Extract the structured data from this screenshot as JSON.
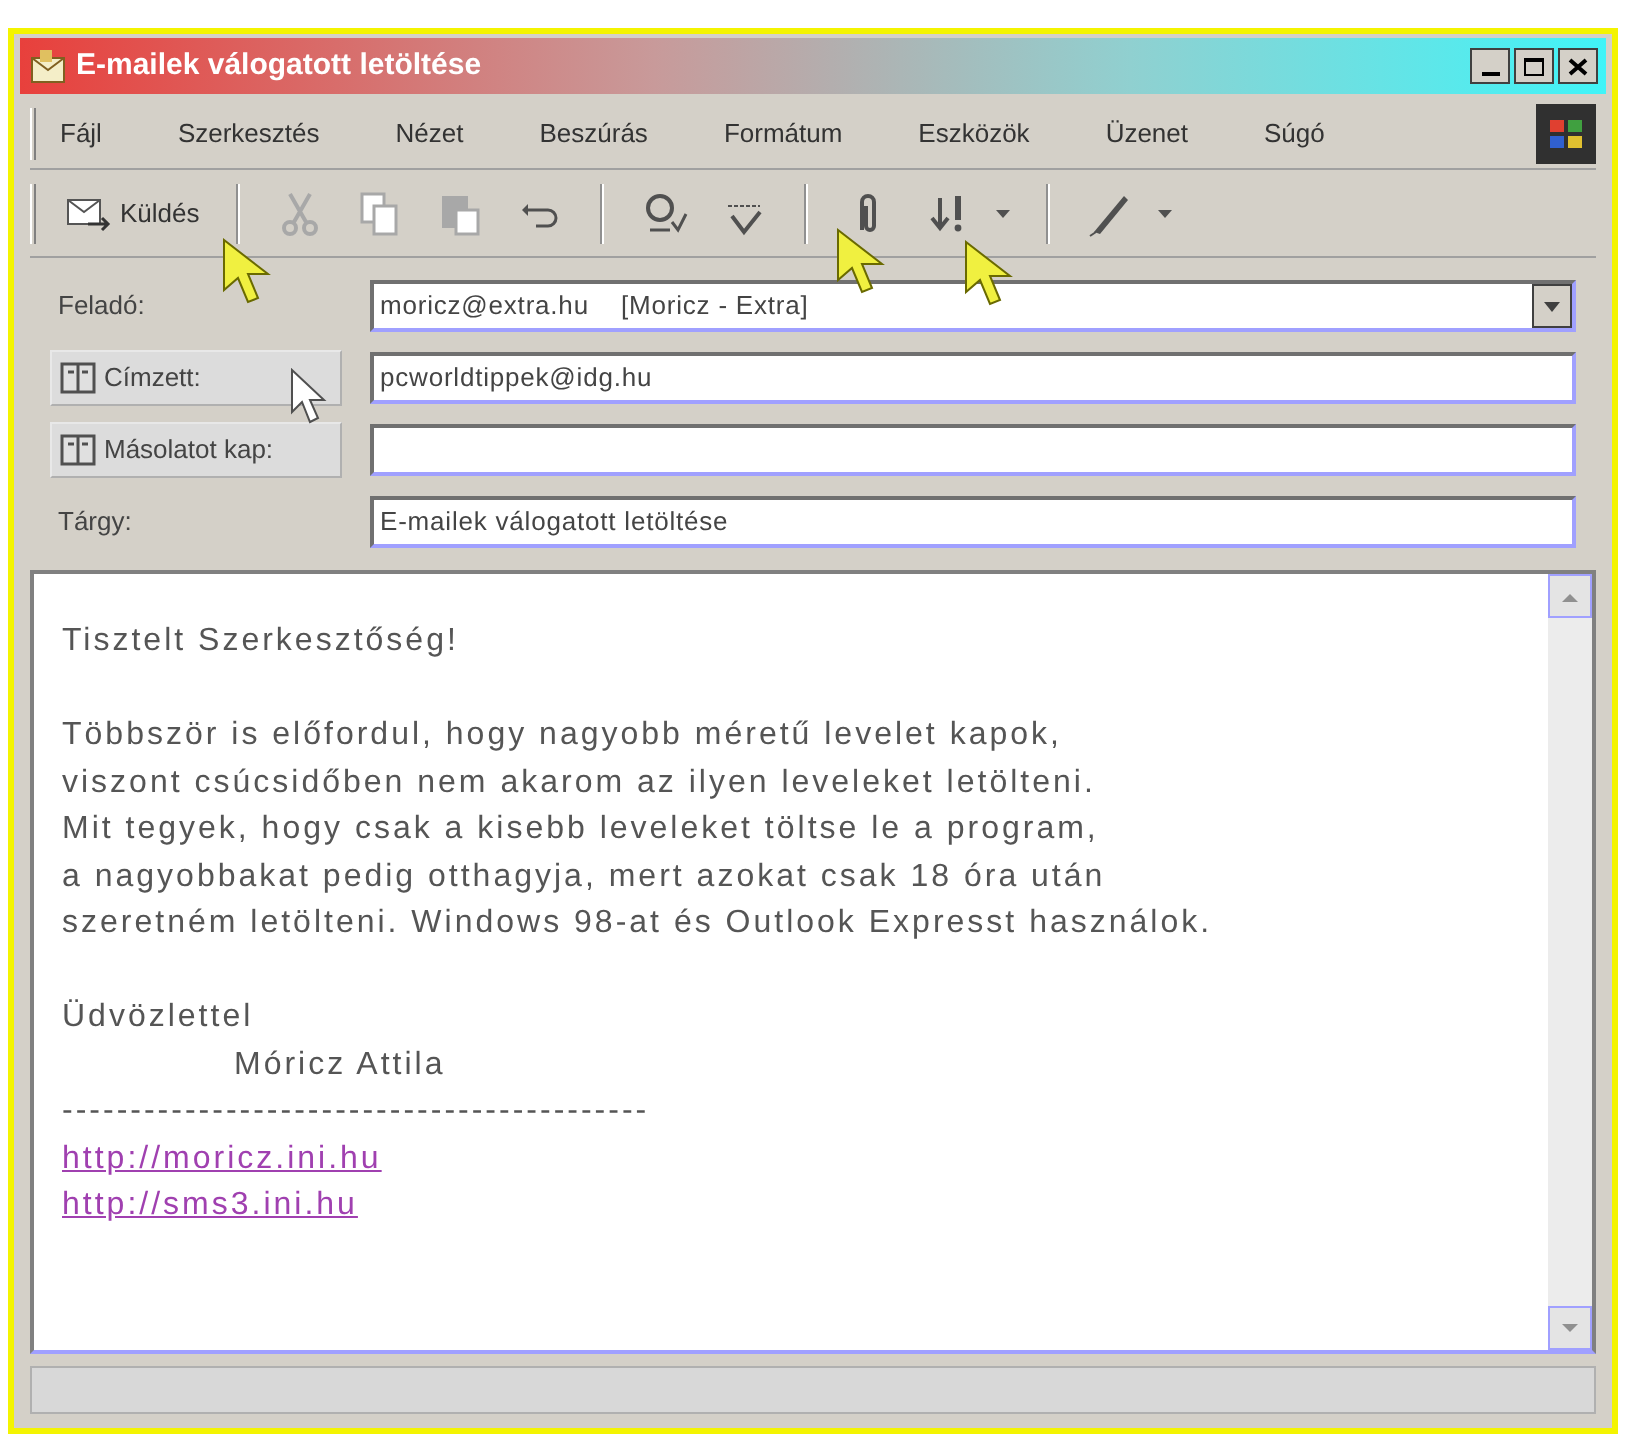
{
  "window": {
    "title": "E-mailek válogatott letöltése"
  },
  "menu": [
    "Fájl",
    "Szerkesztés",
    "Nézet",
    "Beszúrás",
    "Formátum",
    "Eszközök",
    "Üzenet",
    "Súgó"
  ],
  "toolbar": [
    {
      "kind": "send",
      "label": "Küldés",
      "disabled": false
    },
    {
      "kind": "separator"
    },
    {
      "kind": "cut",
      "disabled": true
    },
    {
      "kind": "copy",
      "disabled": true
    },
    {
      "kind": "paste",
      "disabled": true
    },
    {
      "kind": "undo",
      "disabled": false
    },
    {
      "kind": "separator"
    },
    {
      "kind": "check",
      "disabled": false
    },
    {
      "kind": "spell",
      "disabled": false
    },
    {
      "kind": "separator"
    },
    {
      "kind": "attach",
      "disabled": false
    },
    {
      "kind": "priority",
      "disabled": false
    },
    {
      "kind": "separator"
    },
    {
      "kind": "sign",
      "disabled": false
    }
  ],
  "header": [
    {
      "kind": "combo",
      "label": "Feladó:",
      "value": "moricz@extra.hu    [Moricz - Extra]"
    },
    {
      "kind": "button",
      "label": "Címzett:",
      "value": "pcworldtippek@idg.hu"
    },
    {
      "kind": "button",
      "label": "Másolatot kap:"
    },
    {
      "kind": "plain",
      "label": "Tárgy:",
      "value": "E-mailek válogatott letöltése"
    }
  ],
  "body": [
    {
      "kind": "text",
      "text": "Tisztelt Szerkesztőség!"
    },
    {
      "kind": "blank"
    },
    {
      "kind": "text",
      "text": "Többször is előfordul, hogy nagyobb méretű levelet kapok,"
    },
    {
      "kind": "text",
      "text": "viszont csúcsidőben nem akarom az ilyen leveleket letölteni."
    },
    {
      "kind": "text",
      "text": "Mit tegyek, hogy csak a kisebb leveleket töltse le a program,"
    },
    {
      "kind": "text",
      "text": "a nagyobbakat pedig otthagyja, mert azokat csak 18 óra után"
    },
    {
      "kind": "text",
      "text": "szeretném letölteni. Windows 98-at és Outlook Expresst használok."
    },
    {
      "kind": "blank"
    },
    {
      "kind": "text",
      "text": "Üdvözlettel"
    },
    {
      "kind": "indented",
      "text": "Móricz Attila"
    },
    {
      "kind": "text",
      "text": "-------------------------------------------"
    },
    {
      "kind": "link",
      "text": "http://moricz.ini.hu"
    },
    {
      "kind": "link",
      "text": "http://sms3.ini.hu"
    }
  ]
}
